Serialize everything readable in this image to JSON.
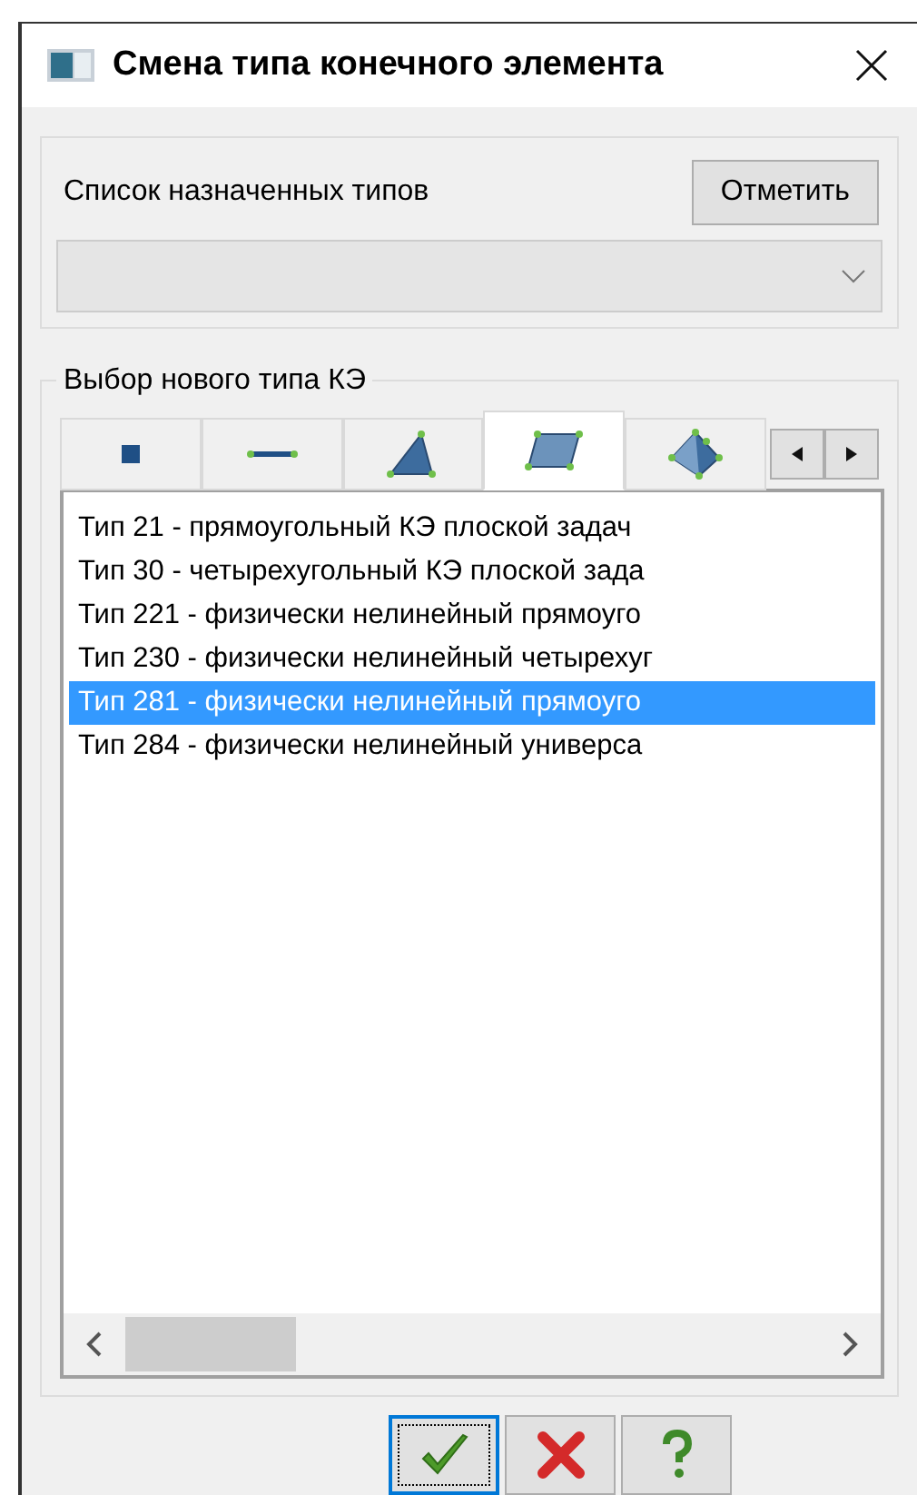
{
  "window": {
    "title": "Смена типа конечного элемента"
  },
  "assigned_group": {
    "label": "Список назначенных типов",
    "mark_button": "Отметить",
    "combo": {
      "disabled": true
    }
  },
  "new_type_group": {
    "title": "Выбор нового типа КЭ",
    "tabs": [
      {
        "kind": "point",
        "selected": false
      },
      {
        "kind": "bar",
        "selected": false
      },
      {
        "kind": "triangle",
        "selected": false
      },
      {
        "kind": "quad",
        "selected": true
      },
      {
        "kind": "solid",
        "selected": false
      }
    ],
    "list": [
      {
        "text": "Тип 21 - прямоугольный КЭ плоской задач",
        "selected": false
      },
      {
        "text": "Тип 30 - четырехугольный КЭ плоской зада",
        "selected": false
      },
      {
        "text": "Тип 221 - физически нелинейный прямоуго",
        "selected": false
      },
      {
        "text": "Тип 230 - физически нелинейный четырехуг",
        "selected": false
      },
      {
        "text": "Тип 281 - физически нелинейный прямоуго",
        "selected": true
      },
      {
        "text": "Тип 284 - физически нелинейный универса",
        "selected": false
      }
    ]
  },
  "buttons": [
    {
      "kind": "ok",
      "focused": true
    },
    {
      "kind": "cancel",
      "focused": false
    },
    {
      "kind": "help",
      "focused": false
    }
  ]
}
